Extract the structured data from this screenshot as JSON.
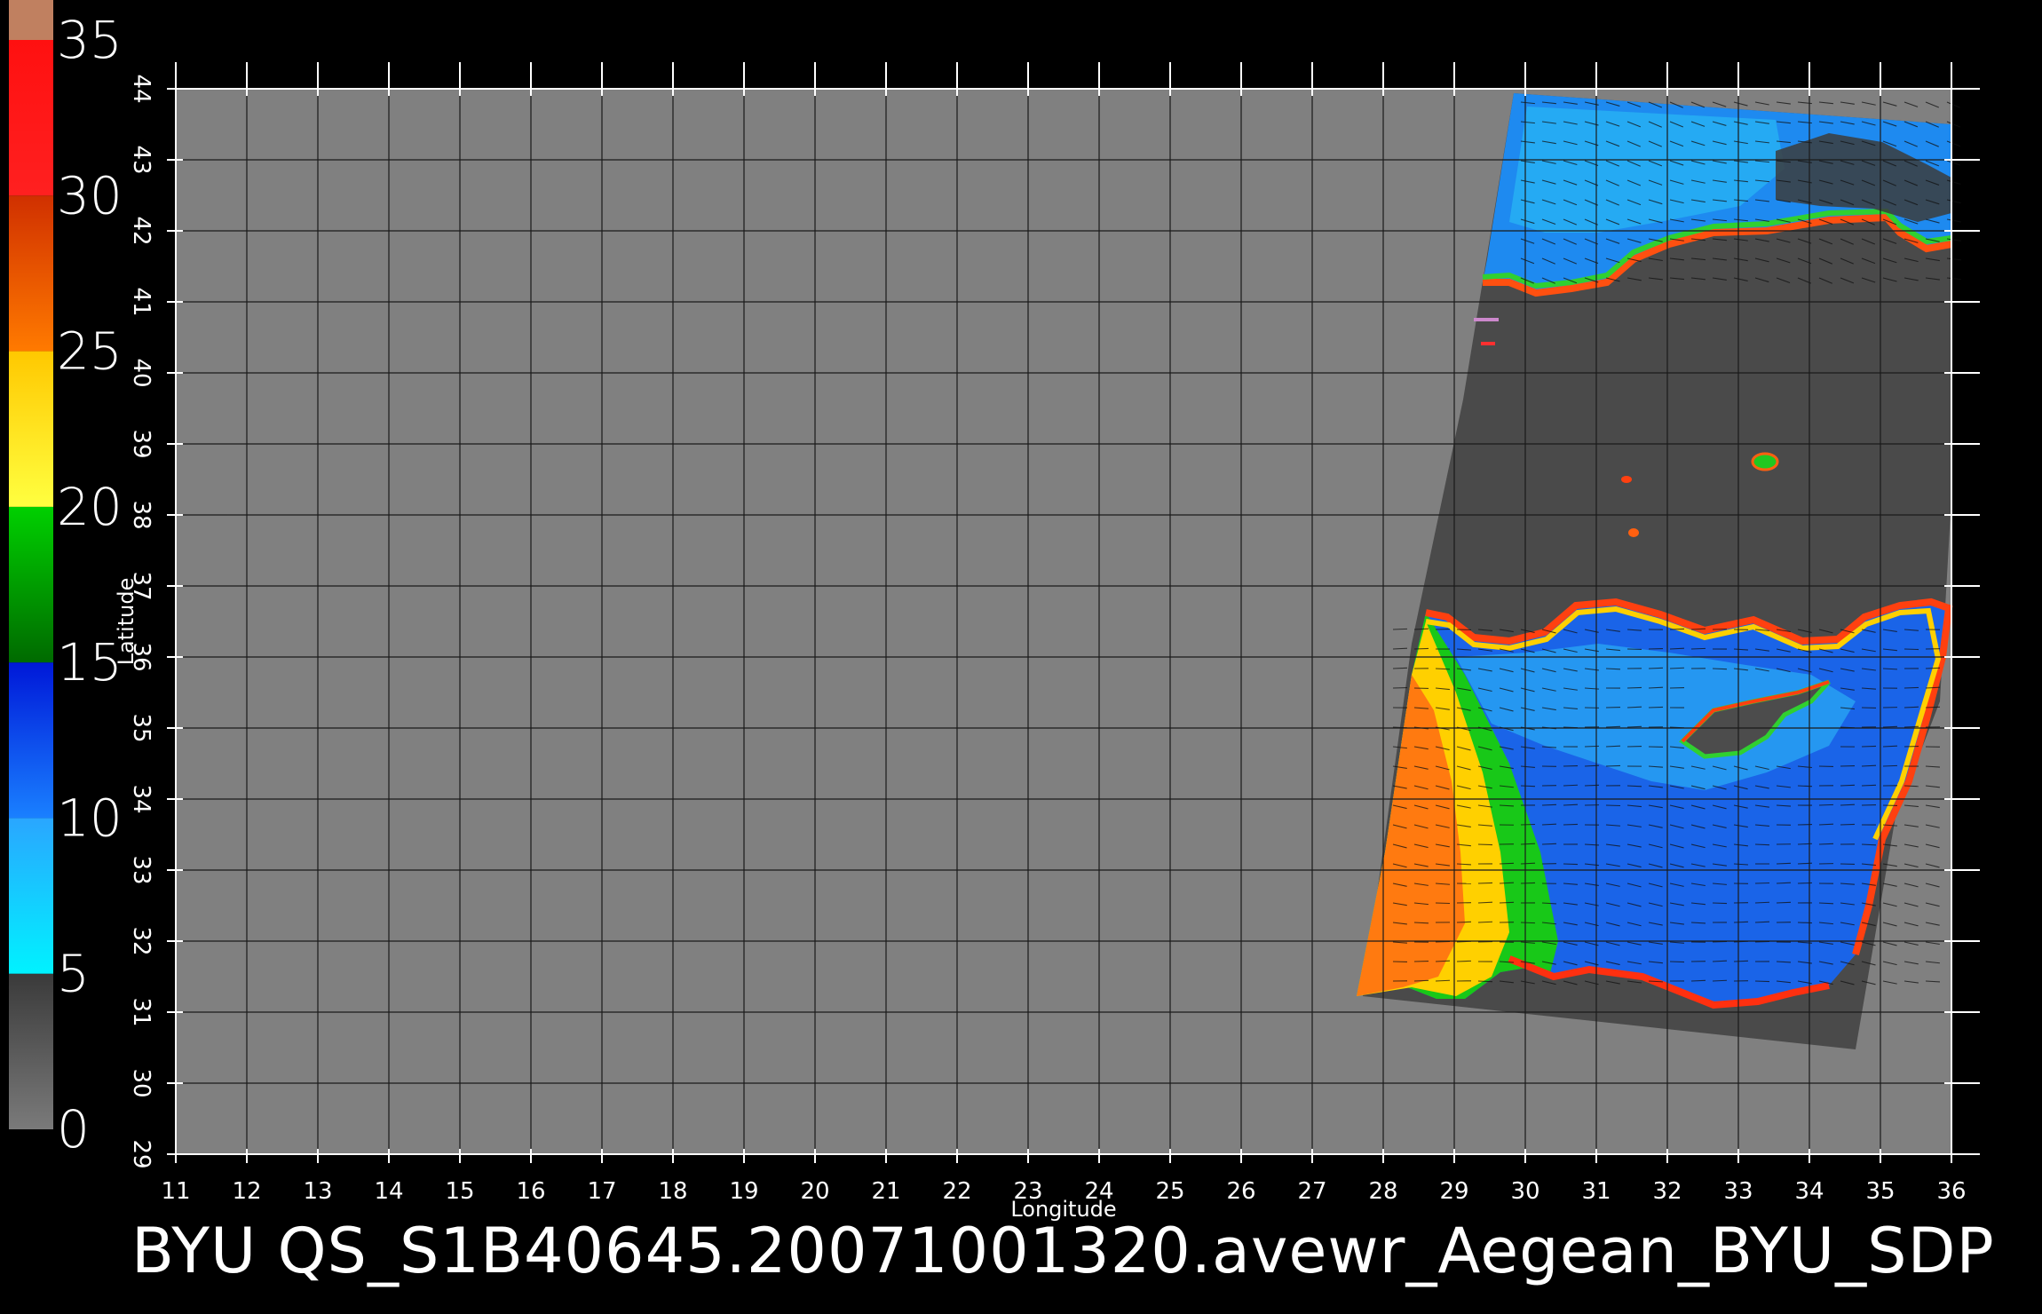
{
  "map": {
    "x_axis_label": "Longitude",
    "y_axis_label": "Latitude",
    "lon_range": [
      11,
      36
    ],
    "lat_range": [
      29,
      44
    ],
    "lon_ticks": [
      "11",
      "12",
      "13",
      "14",
      "15",
      "16",
      "17",
      "18",
      "19",
      "20",
      "21",
      "22",
      "23",
      "24",
      "25",
      "26",
      "27",
      "28",
      "29",
      "30",
      "31",
      "32",
      "33",
      "34",
      "35",
      "36"
    ],
    "lat_ticks": [
      "29",
      "30",
      "31",
      "32",
      "33",
      "34",
      "35",
      "36",
      "37",
      "38",
      "39",
      "40",
      "41",
      "42",
      "43",
      "44"
    ],
    "background_color": "#808080",
    "land_color": "#4a4a4a",
    "grid_color": "#1a1a1a"
  },
  "colorbar": {
    "labels": [
      "0",
      "5",
      "10",
      "15",
      "20",
      "25",
      "30",
      "35"
    ],
    "min": 0,
    "max": 35,
    "segments": [
      {
        "from": 0,
        "to": 5,
        "top_color": "#3a3a3a",
        "bottom_color": "#7a7a7a"
      },
      {
        "from": 5,
        "to": 10,
        "top_color": "#2aa6ff",
        "bottom_color": "#00f2ff"
      },
      {
        "from": 10,
        "to": 15,
        "top_color": "#0018d8",
        "bottom_color": "#1a80ff"
      },
      {
        "from": 15,
        "to": 20,
        "top_color": "#00d000",
        "bottom_color": "#006a00"
      },
      {
        "from": 20,
        "to": 25,
        "top_color": "#ffc800",
        "bottom_color": "#ffff40"
      },
      {
        "from": 25,
        "to": 30,
        "top_color": "#d03000",
        "bottom_color": "#ff7a00"
      },
      {
        "from": 30,
        "to": 35,
        "top_color": "#ff1010",
        "bottom_color": "#ff2020"
      }
    ],
    "cap_color": "#c08060"
  },
  "footer": {
    "title": "BYU  QS_S1B40645.20071001320.avewr_Aegean_BYU_SDP"
  }
}
